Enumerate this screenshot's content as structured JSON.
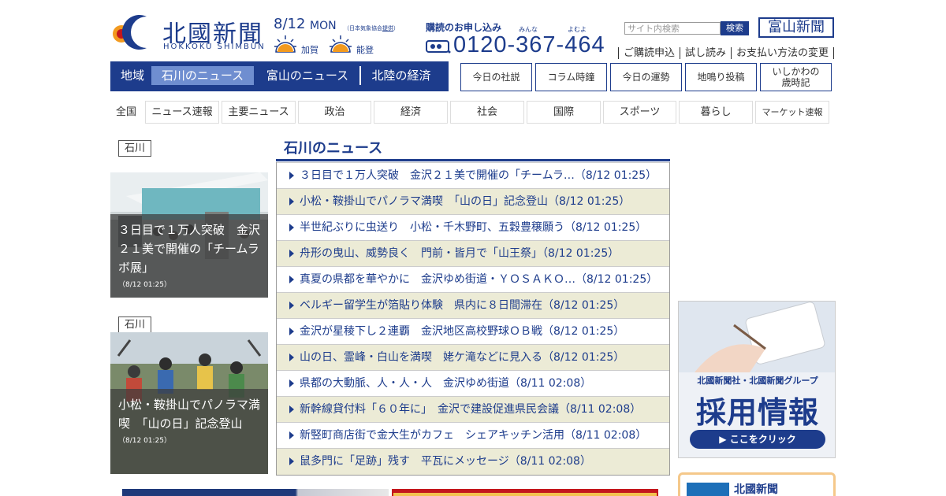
{
  "header": {
    "logo_text": "北國新聞",
    "logo_sub": "HOKKOKU SHIMBUN",
    "date": "8/12",
    "day": "MON",
    "weather_source_prefix": "（日本気象協会",
    "weather_source_link": "提供",
    "weather_source_suffix": "）",
    "weather": [
      {
        "place": "加賀",
        "icon": "sunny-icon"
      },
      {
        "place": "能登",
        "icon": "sunny-icon"
      }
    ],
    "subscription_title": "購読のお申し込み",
    "phone_ruby": [
      "みんな",
      "よむよ"
    ],
    "phone": "0120-367-464",
    "search_placeholder": "サイト内検索",
    "search_button": "検索",
    "toyama_button": "富山新聞",
    "utility_links": [
      "ご購読申込",
      "試し読み",
      "お支払い方法の変更"
    ]
  },
  "region_nav": {
    "label": "地域",
    "items": [
      {
        "label": "石川のニュース",
        "active": true
      },
      {
        "label": "富山のニュース",
        "active": false
      },
      {
        "label": "北陸の経済",
        "active": false
      }
    ]
  },
  "feature_buttons": [
    "今日の社説",
    "コラム時鐘",
    "今日の運勢",
    "地鳴り投稿",
    "いしかわの\n歳時記"
  ],
  "categories": {
    "label": "全国",
    "tabs": [
      "ニュース速報",
      "主要ニュース",
      "政治",
      "経済",
      "社会",
      "国際",
      "スポーツ",
      "暮らし",
      "マーケット速報"
    ]
  },
  "featured": [
    {
      "area": "石川",
      "title": "３日目で１万人突破　金沢２１美で開催の「チームラボ展」",
      "date": "（8/12 01:25）"
    },
    {
      "area": "石川",
      "title": "小松・鞍掛山でパノラマ満喫　「山の日」記念登山",
      "date": "（8/12 01:25）"
    }
  ],
  "news": {
    "section_title": "石川のニュース",
    "items": [
      {
        "text": "３日目で１万人突破　金沢２１美で開催の「チームラ…（8/12 01:25）"
      },
      {
        "text": "小松・鞍掛山でパノラマ満喫　「山の日」記念登山（8/12 01:25）"
      },
      {
        "text": "半世紀ぶりに虫送り　小松・千木野町、五穀豊穣願う（8/12 01:25）"
      },
      {
        "text": "舟形の曳山、威勢良く　門前・皆月で「山王祭」（8/12 01:25）"
      },
      {
        "text": "真夏の県都を華やかに　金沢ゆめ街道・ＹＯＳＡＫＯ…（8/12 01:25）"
      },
      {
        "text": "ベルギー留学生が箔貼り体験　県内に８日間滞在（8/12 01:25）"
      },
      {
        "text": "金沢が星稜下し２連覇　金沢地区高校野球ＯＢ戦（8/12 01:25）"
      },
      {
        "text": "山の日、霊峰・白山を満喫　姥ケ滝などに見入る（8/12 01:25）"
      },
      {
        "text": "県都の大動脈、人・人・人　金沢ゆめ街道（8/11 02:08）"
      },
      {
        "text": "新幹線貸付料「６０年に」　金沢で建設促進県民会議（8/11 02:08）"
      },
      {
        "text": "新竪町商店街で金大生がカフェ　シェアキッチン活用（8/11 02:08）"
      },
      {
        "text": "鼠多門に「足跡」残す　平瓦にメッセージ（8/11 02:08）"
      }
    ]
  },
  "banner": {
    "subtitle": "北國新聞社・北國新聞グループ",
    "title": "採用情報",
    "button": "▶ ここをクリック"
  },
  "bottom_card": {
    "title": "北國新聞"
  },
  "colors": {
    "brand": "#1d3c8c",
    "active_tab": "#6f8ed0",
    "alt_row": "#ecebd6"
  }
}
